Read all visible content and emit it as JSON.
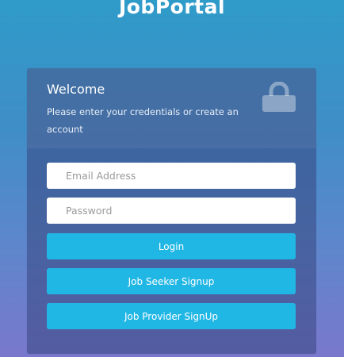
{
  "app": {
    "title": "JobPortal"
  },
  "card": {
    "title": "Welcome",
    "subtitle": "Please enter your credentials or create an account",
    "icon": "lock-icon"
  },
  "form": {
    "email": {
      "placeholder": "Email Address",
      "value": ""
    },
    "password": {
      "placeholder": "Password",
      "value": ""
    }
  },
  "buttons": {
    "login": "Login",
    "job_seeker_signup": "Job Seeker Signup",
    "job_provider_signup": "Job Provider SignUp"
  },
  "colors": {
    "button": "#21b7e5",
    "background_top": "#2f9bc9",
    "background_bottom": "#7a78cc"
  }
}
